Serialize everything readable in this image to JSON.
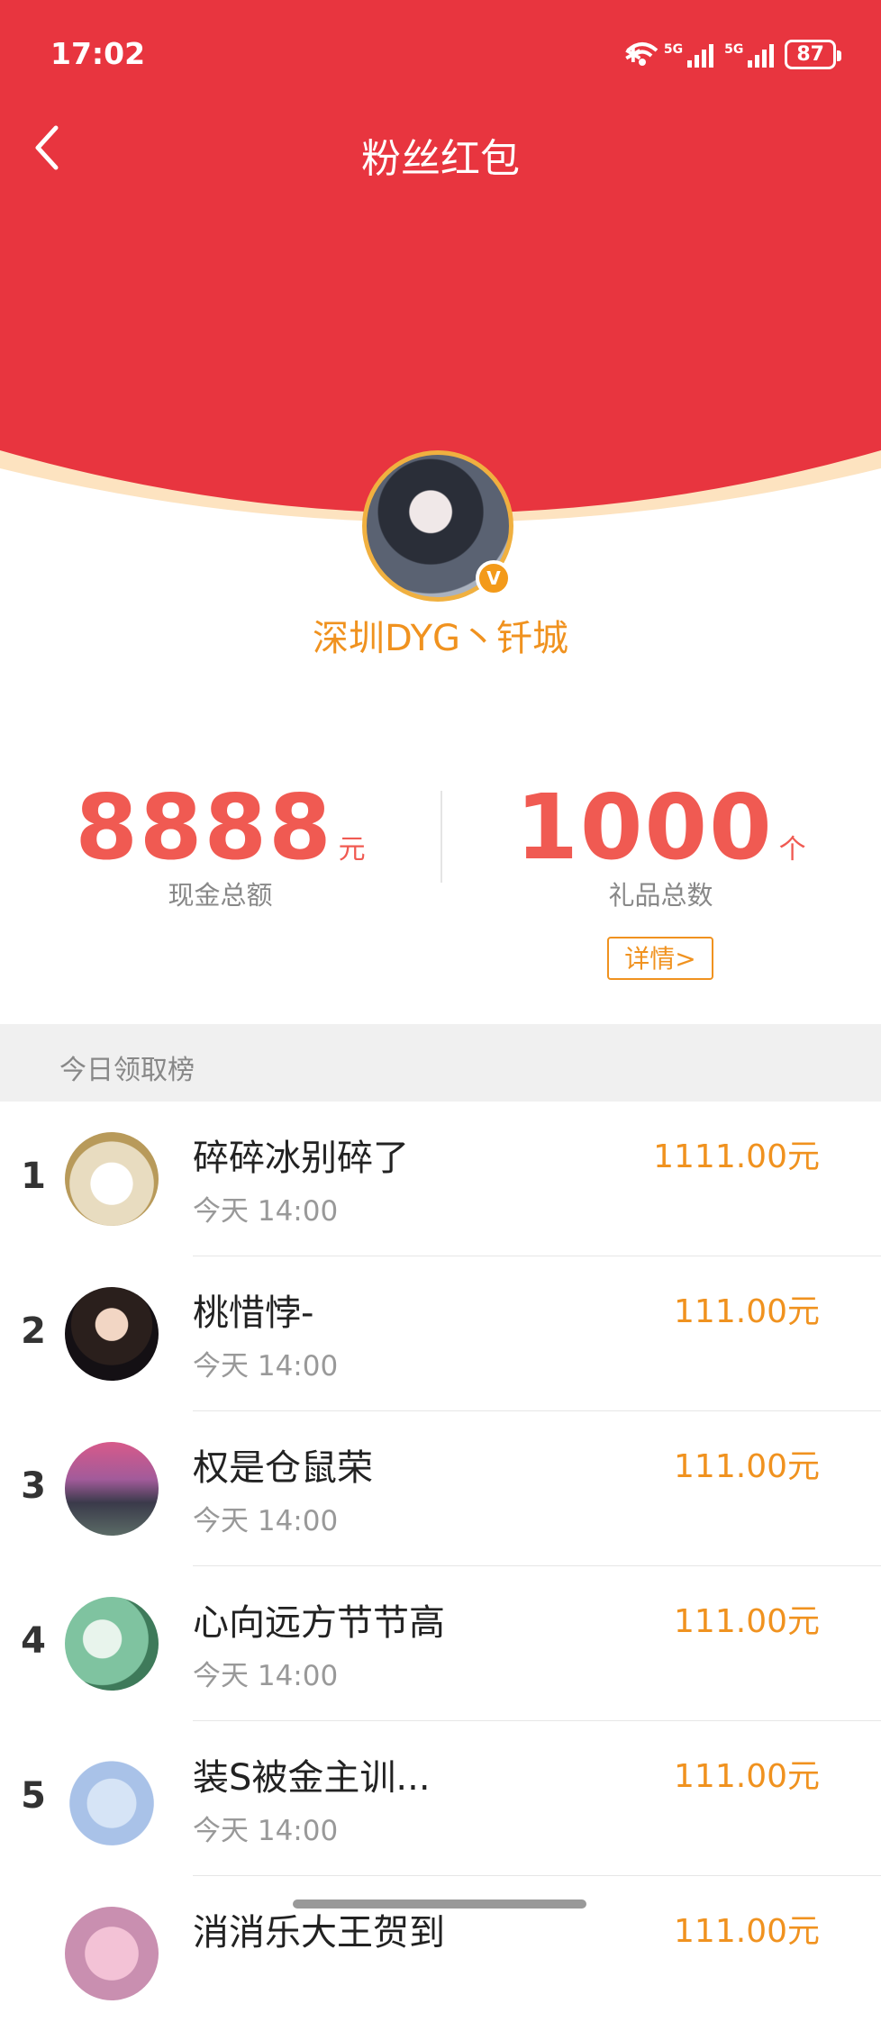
{
  "status": {
    "time": "17:02",
    "network1": "5G",
    "network2": "5G",
    "battery": "87"
  },
  "header": {
    "title": "粉丝红包"
  },
  "profile": {
    "username": "深圳DYG丶钎城",
    "badge": "V"
  },
  "stats": {
    "cash": {
      "value": "8888",
      "unit": "元",
      "label": "现金总额"
    },
    "gifts": {
      "value": "1000",
      "unit": "个",
      "label": "礼品总数"
    },
    "detail_label": "详情>"
  },
  "leaderboard": {
    "title": "今日领取榜",
    "rows": [
      {
        "rank": "1",
        "name": "碎碎冰别碎了",
        "time": "今天 14:00",
        "amount": "1111.00元"
      },
      {
        "rank": "2",
        "name": "桃惜悖-",
        "time": "今天 14:00",
        "amount": "111.00元"
      },
      {
        "rank": "3",
        "name": "权是仓鼠荣",
        "time": "今天 14:00",
        "amount": "111.00元"
      },
      {
        "rank": "4",
        "name": "心向远方节节高",
        "time": "今天 14:00",
        "amount": "111.00元"
      },
      {
        "rank": "5",
        "name": "装S被金主训...",
        "time": "今天 14:00",
        "amount": "111.00元"
      },
      {
        "rank": "",
        "name": "消消乐大王贺到",
        "time": "",
        "amount": "111.00元"
      }
    ]
  },
  "colors": {
    "header_red": "#e8353f",
    "accent_orange": "#f0921f",
    "stat_red": "#f05a52"
  }
}
